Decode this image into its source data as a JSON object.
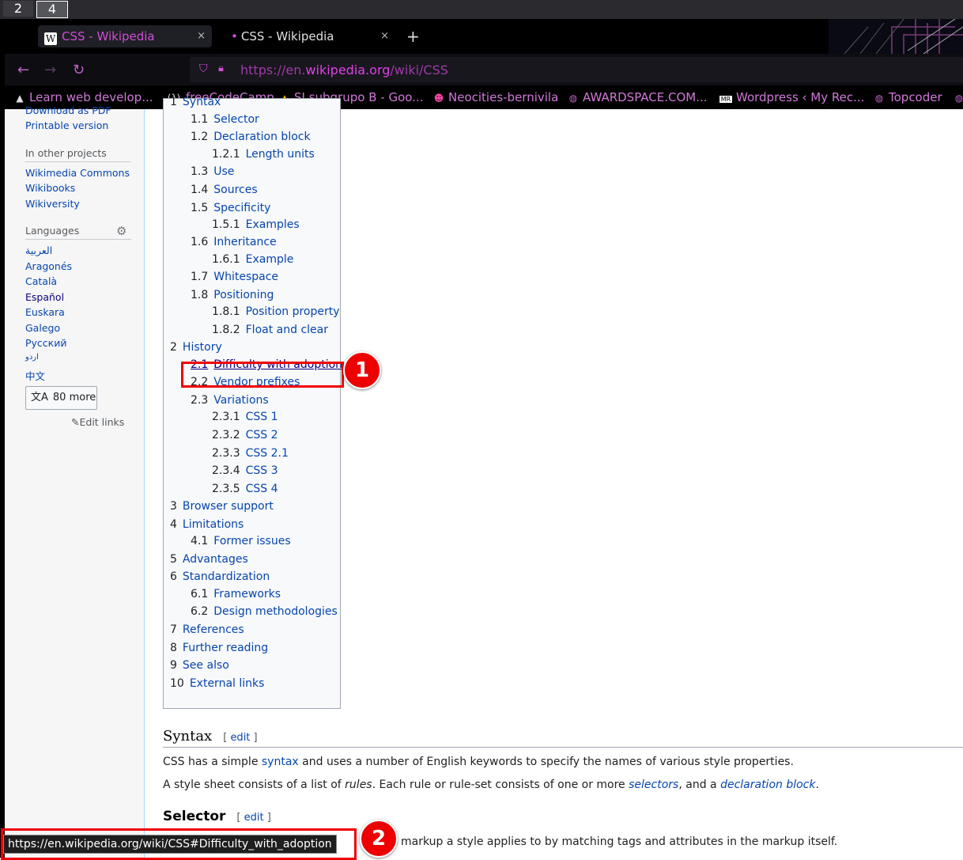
{
  "workspaces": [
    "2",
    "4"
  ],
  "tabs": [
    {
      "title": "CSS - Wikipedia",
      "icon": "W",
      "close": "×"
    },
    {
      "title": "CSS - Wikipedia",
      "close": "×"
    }
  ],
  "new_tab": "+",
  "nav": {
    "back": "←",
    "forward": "→",
    "reload": "↻"
  },
  "url": {
    "prefix": "https://en.",
    "domain": "wikipedia.org",
    "path": "/wiki/CSS"
  },
  "bookmarks": [
    {
      "icon": "fcc-icon",
      "label": "Learn web develop..."
    },
    {
      "icon": "(λ)",
      "label": "freeCodeCamp"
    },
    {
      "icon": "drive-icon",
      "label": "SI subgrupo B - Goo..."
    },
    {
      "icon": "neocities-icon",
      "label": "Neocities-bernivila"
    },
    {
      "icon": "globe-icon",
      "label": "AWARDSPACE.COM..."
    },
    {
      "icon": "MR",
      "label": "Wordpress ‹ My Rec..."
    },
    {
      "icon": "globe-icon",
      "label": "Topcoder"
    }
  ],
  "sidebar": {
    "tools_items": [
      "Download as PDF",
      "Printable version"
    ],
    "other_projects_title": "In other projects",
    "other_projects": [
      "Wikimedia Commons",
      "Wikibooks",
      "Wikiversity"
    ],
    "languages_title": "Languages",
    "languages": [
      "العربية",
      "Aragonés",
      "Català",
      "Español",
      "Euskara",
      "Galego",
      "Русский",
      "اردو",
      "中文"
    ],
    "more_label": "80 more",
    "edit_links": "Edit links"
  },
  "toc": [
    {
      "num": "1",
      "label": "Syntax",
      "level": 1
    },
    {
      "num": "1.1",
      "label": "Selector",
      "level": 2
    },
    {
      "num": "1.2",
      "label": "Declaration block",
      "level": 2
    },
    {
      "num": "1.2.1",
      "label": "Length units",
      "level": 3
    },
    {
      "num": "1.3",
      "label": "Use",
      "level": 2
    },
    {
      "num": "1.4",
      "label": "Sources",
      "level": 2
    },
    {
      "num": "1.5",
      "label": "Specificity",
      "level": 2
    },
    {
      "num": "1.5.1",
      "label": "Examples",
      "level": 3
    },
    {
      "num": "1.6",
      "label": "Inheritance",
      "level": 2
    },
    {
      "num": "1.6.1",
      "label": "Example",
      "level": 3
    },
    {
      "num": "1.7",
      "label": "Whitespace",
      "level": 2
    },
    {
      "num": "1.8",
      "label": "Positioning",
      "level": 2
    },
    {
      "num": "1.8.1",
      "label": "Position property",
      "level": 3
    },
    {
      "num": "1.8.2",
      "label": "Float and clear",
      "level": 3
    },
    {
      "num": "2",
      "label": "History",
      "level": 1
    },
    {
      "num": "2.1",
      "label": "Difficulty with adoption",
      "level": 2,
      "hovered": true
    },
    {
      "num": "2.2",
      "label": "Vendor prefixes",
      "level": 2
    },
    {
      "num": "2.3",
      "label": "Variations",
      "level": 2
    },
    {
      "num": "2.3.1",
      "label": "CSS 1",
      "level": 3
    },
    {
      "num": "2.3.2",
      "label": "CSS 2",
      "level": 3
    },
    {
      "num": "2.3.3",
      "label": "CSS 2.1",
      "level": 3
    },
    {
      "num": "2.3.4",
      "label": "CSS 3",
      "level": 3
    },
    {
      "num": "2.3.5",
      "label": "CSS 4",
      "level": 3
    },
    {
      "num": "3",
      "label": "Browser support",
      "level": 1
    },
    {
      "num": "4",
      "label": "Limitations",
      "level": 1
    },
    {
      "num": "4.1",
      "label": "Former issues",
      "level": 2
    },
    {
      "num": "5",
      "label": "Advantages",
      "level": 1
    },
    {
      "num": "6",
      "label": "Standardization",
      "level": 1
    },
    {
      "num": "6.1",
      "label": "Frameworks",
      "level": 2
    },
    {
      "num": "6.2",
      "label": "Design methodologies",
      "level": 2
    },
    {
      "num": "7",
      "label": "References",
      "level": 1
    },
    {
      "num": "8",
      "label": "Further reading",
      "level": 1
    },
    {
      "num": "9",
      "label": "See also",
      "level": 1
    },
    {
      "num": "10",
      "label": "External links",
      "level": 1
    }
  ],
  "section_syntax": {
    "title": "Syntax",
    "edit_open": "[",
    "edit_label": "edit",
    "edit_close": "]",
    "p1": [
      "CSS has a simple ",
      "syntax",
      " and uses a number of English keywords to specify the names of various style properties."
    ],
    "p2": [
      "A style sheet consists of a list of ",
      "rules",
      ". Each rule or rule-set consists of one or more ",
      "selectors",
      ", and a ",
      "declaration block",
      "."
    ]
  },
  "section_selector": {
    "title": "Selector",
    "edit_label": "edit",
    "p1_tail": "markup a style applies to by matching tags and attributes in the markup itself."
  },
  "status_url": "https://en.wikipedia.org/wiki/CSS#Difficulty_with_adoption",
  "annotations": [
    "1",
    "2"
  ],
  "colors": {
    "link": "#0645ad",
    "accent": "#d14dd4",
    "highlight": "#ee0000"
  }
}
